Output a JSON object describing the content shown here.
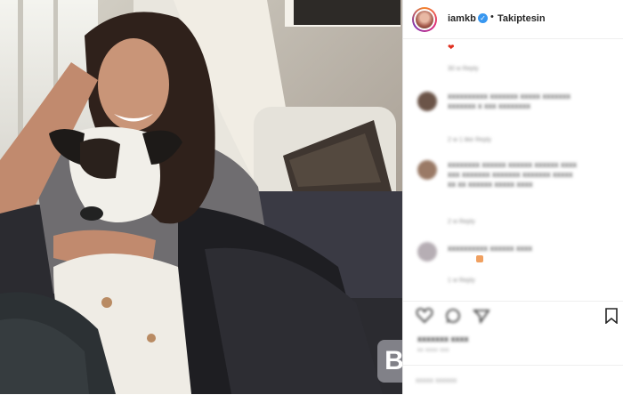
{
  "header": {
    "username": "iamkb",
    "verified_mark": "✓",
    "separator": "•",
    "follow_label": "Takiptesin"
  },
  "comments": [
    {
      "text": "❤",
      "meta": "30 w   Reply"
    },
    {
      "text": "xxxxxxxxxx xxxxxxx xxxxx xxxxxxx xxxxxxx x xxx xxxxxxxx",
      "meta": "2 w   1 like   Reply"
    },
    {
      "text": "xxxxxxxx xxxxxx xxxxxx xxxxxx xxxx xxx xxxxxxx xxxxxxx xxxxxxx xxxxx xx xx xxxxxx xxxxx xxxx",
      "meta": "2 w   Reply"
    },
    {
      "text": "xxxxxxxxxx xxxxxx xxxx",
      "meta": "1 w   Reply"
    }
  ],
  "actions": {
    "like_icon": "heart-icon",
    "comment_icon": "comment-icon",
    "share_icon": "share-icon",
    "save_icon": "bookmark-icon"
  },
  "likes_text": "xxxxxxx xxxx",
  "date_text": "xx xxxx xxx",
  "add_comment_placeholder": "xxxxx xxxxxx",
  "colors": {
    "accent": "#3897f0",
    "ring": "#dd2a7b",
    "photo_tone": "#7d7265"
  }
}
